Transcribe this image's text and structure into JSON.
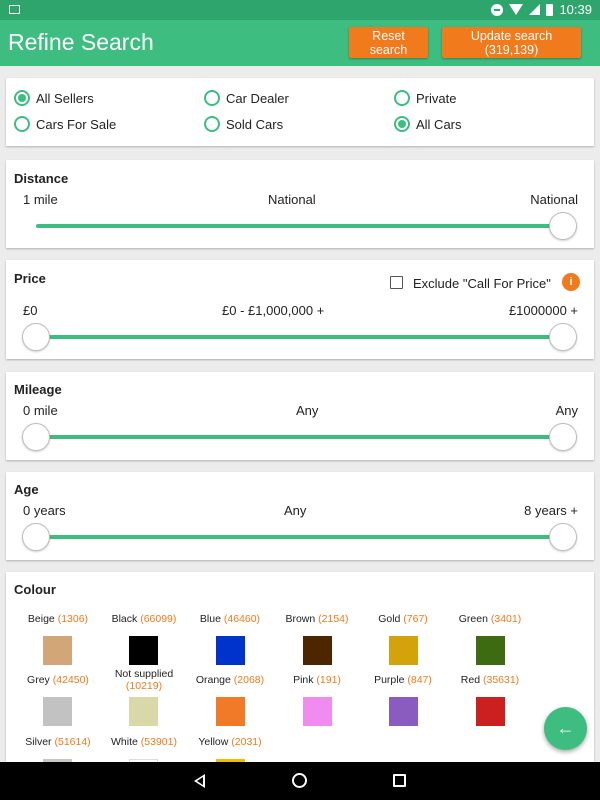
{
  "status_bar": {
    "time": "10:39"
  },
  "header": {
    "title": "Refine Search",
    "reset_label": "Reset search",
    "update_label": "Update search (319,139)"
  },
  "seller_options": [
    {
      "label": "All Sellers",
      "selected": true
    },
    {
      "label": "Car Dealer",
      "selected": false
    },
    {
      "label": "Private",
      "selected": false
    },
    {
      "label": "Cars For Sale",
      "selected": false
    },
    {
      "label": "Sold Cars",
      "selected": false
    },
    {
      "label": "All Cars",
      "selected": true
    }
  ],
  "distance": {
    "title": "Distance",
    "min": "1 mile",
    "current": "National",
    "max": "National",
    "value_fraction": 1.0
  },
  "price": {
    "title": "Price",
    "exclude_label": "Exclude \"Call For Price\"",
    "exclude_checked": false,
    "info_icon": "i",
    "min": "£0",
    "current": "£0 - £1,000,000 +",
    "max": "£1000000 +",
    "range_fraction": [
      0.0,
      1.0
    ]
  },
  "mileage": {
    "title": "Mileage",
    "min": "0 mile",
    "current": "Any",
    "max": "Any",
    "range_fraction": [
      0.0,
      1.0
    ]
  },
  "age": {
    "title": "Age",
    "min": "0 years",
    "current": "Any",
    "max": "8 years +",
    "range_fraction": [
      0.0,
      1.0
    ]
  },
  "colour": {
    "title": "Colour",
    "items": [
      {
        "name": "Beige",
        "count": "(1306)",
        "color": "#d2a679"
      },
      {
        "name": "Black",
        "count": "(66099)",
        "color": "#000000"
      },
      {
        "name": "Blue",
        "count": "(46460)",
        "color": "#0033cc"
      },
      {
        "name": "Brown",
        "count": "(2154)",
        "color": "#4d2600"
      },
      {
        "name": "Gold",
        "count": "(767)",
        "color": "#d4a20a"
      },
      {
        "name": "Green",
        "count": "(3401)",
        "color": "#3d6b12"
      },
      {
        "name": "Grey",
        "count": "(42450)",
        "color": "#c2c2c2"
      },
      {
        "name": "Not supplied",
        "count": "(10219)",
        "color": "#d8d8a8"
      },
      {
        "name": "Orange",
        "count": "(2068)",
        "color": "#f07a28"
      },
      {
        "name": "Pink",
        "count": "(191)",
        "color": "#f08cf0"
      },
      {
        "name": "Purple",
        "count": "(847)",
        "color": "#8a5cbf"
      },
      {
        "name": "Red",
        "count": "(35631)",
        "color": "#cc1f1f"
      },
      {
        "name": "Silver",
        "count": "(51614)",
        "color": "#c8c8c0"
      },
      {
        "name": "White",
        "count": "(53901)",
        "color": "#ffffff"
      },
      {
        "name": "Yellow",
        "count": "(2031)",
        "color": "#f0c000"
      }
    ]
  },
  "fab_icon": "arrow-left-icon",
  "nav": {
    "back_icon": "back-triangle-icon",
    "home_icon": "home-circle-icon",
    "recents_icon": "recents-square-icon"
  }
}
